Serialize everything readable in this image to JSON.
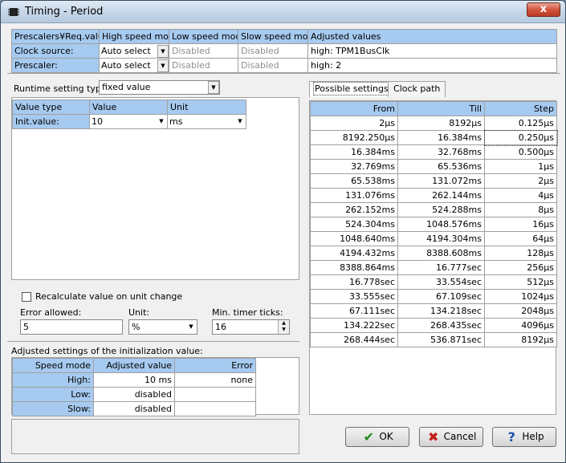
{
  "window": {
    "title": "Timing - Period",
    "close_label": "x"
  },
  "prescalers": {
    "headers": [
      "Prescalers¥Req.value",
      "High speed mode",
      "Low speed mode",
      "Slow speed mode",
      "Adjusted values"
    ],
    "rows": [
      {
        "label": "Clock source:",
        "high": "Auto select",
        "low": "Disabled",
        "slow": "Disabled",
        "adjusted": "high: TPM1BusClk"
      },
      {
        "label": "Prescaler:",
        "high": "Auto select",
        "low": "Disabled",
        "slow": "Disabled",
        "adjusted": "high: 2"
      }
    ]
  },
  "runtime": {
    "label": "Runtime setting type:",
    "value": "fixed value"
  },
  "value_table": {
    "headers": [
      "Value type",
      "Value",
      "Unit"
    ],
    "row": {
      "type": "Init.value:",
      "value": "10",
      "unit": "ms"
    }
  },
  "recalc": {
    "label": "Recalculate value on unit change",
    "checked": false
  },
  "error_allowed": {
    "label": "Error allowed:",
    "value": "5"
  },
  "unit": {
    "label": "Unit:",
    "value": "%"
  },
  "min_ticks": {
    "label": "Min. timer ticks:",
    "value": "16"
  },
  "adjusted": {
    "title": "Adjusted settings of the initialization value:",
    "headers": [
      "Speed mode",
      "Adjusted value",
      "Error"
    ],
    "rows": [
      {
        "mode": "High:",
        "value": "10 ms",
        "error": "none"
      },
      {
        "mode": "Low:",
        "value": "disabled",
        "error": ""
      },
      {
        "mode": "Slow:",
        "value": "disabled",
        "error": ""
      }
    ]
  },
  "tabs": [
    {
      "label": "Possible settings",
      "active": true
    },
    {
      "label": "Clock path",
      "active": false
    }
  ],
  "possible": {
    "headers": [
      "From",
      "Till",
      "Step"
    ],
    "rows": [
      [
        "2µs",
        "8192µs",
        "0.125µs"
      ],
      [
        "8192.250µs",
        "16.384ms",
        "0.250µs"
      ],
      [
        "16.384ms",
        "32.768ms",
        "0.500µs"
      ],
      [
        "32.769ms",
        "65.536ms",
        "1µs"
      ],
      [
        "65.538ms",
        "131.072ms",
        "2µs"
      ],
      [
        "131.076ms",
        "262.144ms",
        "4µs"
      ],
      [
        "262.152ms",
        "524.288ms",
        "8µs"
      ],
      [
        "524.304ms",
        "1048.576ms",
        "16µs"
      ],
      [
        "1048.640ms",
        "4194.304ms",
        "64µs"
      ],
      [
        "4194.432ms",
        "8388.608ms",
        "128µs"
      ],
      [
        "8388.864ms",
        "16.777sec",
        "256µs"
      ],
      [
        "16.778sec",
        "33.554sec",
        "512µs"
      ],
      [
        "33.555sec",
        "67.109sec",
        "1024µs"
      ],
      [
        "67.111sec",
        "134.218sec",
        "2048µs"
      ],
      [
        "134.222sec",
        "268.435sec",
        "4096µs"
      ],
      [
        "268.444sec",
        "536.871sec",
        "8192µs"
      ]
    ]
  },
  "buttons": {
    "ok": "OK",
    "cancel": "Cancel",
    "help": "Help"
  },
  "colors": {
    "header_bg": "#a6caf0",
    "ok_icon": "#1a8a1a",
    "cancel_icon": "#c0201a",
    "help_icon": "#1a4fb0"
  }
}
